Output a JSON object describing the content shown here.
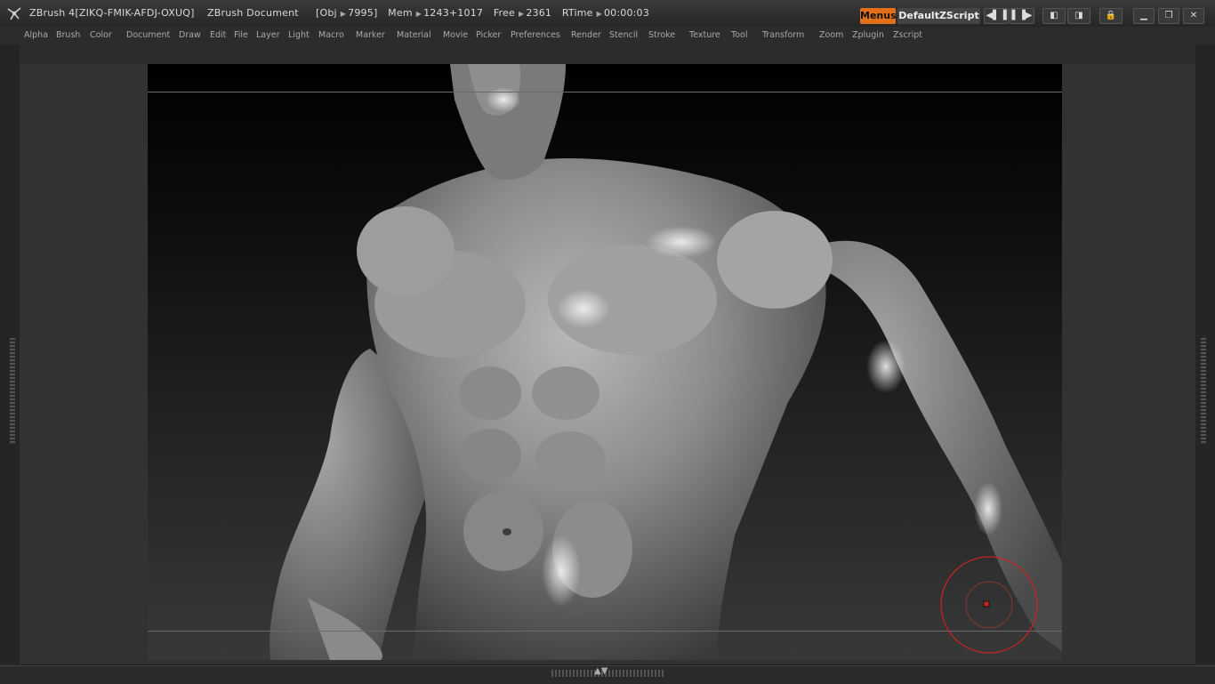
{
  "titlebar": {
    "app_title": "ZBrush 4[ZIKQ-FMIK-AFDJ-OXUQ]",
    "document": "ZBrush Document",
    "obj_label": "[Obj",
    "obj_value": "7995]",
    "mem_label": "Mem",
    "mem_value": "1243+1017",
    "free_label": "Free",
    "free_value": "2361",
    "rtime_label": "RTime",
    "rtime_value": "00:00:03",
    "menus_button": "Menus",
    "script_button": "DefaultZScript"
  },
  "menubar": {
    "items": [
      "Alpha",
      "Brush",
      "Color",
      "Document",
      "Draw",
      "Edit",
      "File",
      "Layer",
      "Light",
      "Macro",
      "Marker",
      "Material",
      "Movie",
      "Picker",
      "Preferences",
      "Render",
      "Stencil",
      "Stroke",
      "Texture",
      "Tool",
      "Transform",
      "Zoom",
      "Zplugin",
      "Zscript"
    ]
  },
  "canvas": {
    "subject": "sculpted male torso",
    "brush_cursor_color": "#cc2222"
  },
  "colors": {
    "accent": "#e2701a",
    "background": "#1e1e1e",
    "panel": "#323232"
  }
}
